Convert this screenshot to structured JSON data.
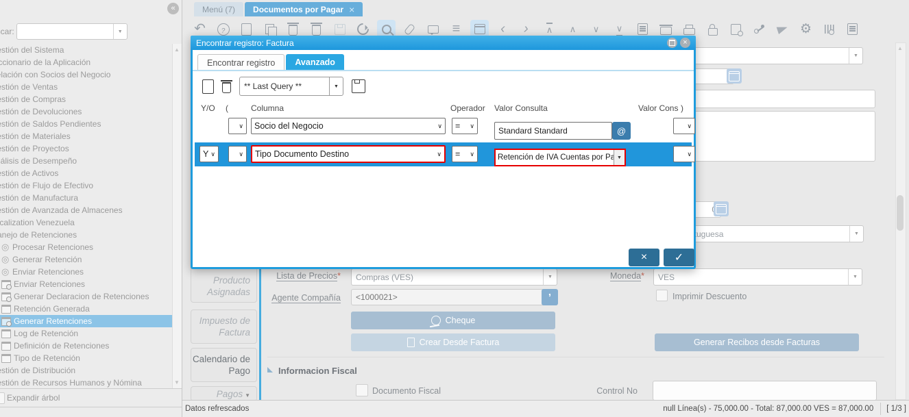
{
  "window": {
    "tabs": [
      {
        "label": "Menú (7)",
        "active": false
      },
      {
        "label": "Documentos por Pagar",
        "active": true,
        "close": "×"
      }
    ]
  },
  "sidebar": {
    "search_label": "Buscar:",
    "tree": [
      {
        "label": "Gestión del Sistema"
      },
      {
        "label": "Diccionario de la Aplicación"
      },
      {
        "label": "Relación con Socios del Negocio"
      },
      {
        "label": "Gestión de Ventas"
      },
      {
        "label": "Gestión de Compras"
      },
      {
        "label": "Gestión de Devoluciones"
      },
      {
        "label": "Gestión de Saldos Pendientes"
      },
      {
        "label": "Gestión de Materiales"
      },
      {
        "label": "Gestión de Proyectos"
      },
      {
        "label": "Análisis de Desempeño"
      },
      {
        "label": "Gestión de Activos"
      },
      {
        "label": "Gestión de Flujo de Efectivo"
      },
      {
        "label": "Gestión de Manufactura"
      },
      {
        "label": "Gestión de Avanzada de Almacenes"
      },
      {
        "label": "Localization Venezuela"
      },
      {
        "label": "Manejo de Retenciones"
      },
      {
        "label": "Procesar Retenciones",
        "icon": "process"
      },
      {
        "label": "Generar Retención",
        "icon": "process"
      },
      {
        "label": "Enviar Retenciones",
        "icon": "process"
      },
      {
        "label": "Enviar Retenciones",
        "icon": "window-process"
      },
      {
        "label": "Generar Declaracion de Retenciones",
        "icon": "window-process"
      },
      {
        "label": "Retención Generada",
        "icon": "window"
      },
      {
        "label": "Generar Retenciones",
        "icon": "window-process",
        "selected": true
      },
      {
        "label": "Log de Retención",
        "icon": "window"
      },
      {
        "label": "Definición de Retenciones",
        "icon": "window"
      },
      {
        "label": "Tipo de Retención",
        "icon": "window"
      },
      {
        "label": "Gestión de Distribución"
      },
      {
        "label": "Gestión de Recursos Humanos y Nómina"
      }
    ],
    "expand_label": "Expandir árbol"
  },
  "toolbar": {
    "icons": [
      "undo",
      "help",
      "new-record",
      "copy-record",
      "delete-record",
      "delete-selection",
      "save",
      "refresh",
      "find",
      "attachment",
      "chat",
      "grid-toggle",
      "calendar",
      "parent-record",
      "detail-record",
      "first-record",
      "previous-record",
      "next-record",
      "last-record",
      "report",
      "archive",
      "print",
      "lock",
      "zoom-across",
      "workflow",
      "send-mail",
      "preferences",
      "product-info",
      "report-layout"
    ],
    "active_icons": [
      "find",
      "calendar"
    ],
    "disabled_icons": [
      "save"
    ]
  },
  "dialog": {
    "title": "Encontrar registro: Factura",
    "tabs": [
      {
        "label": "Encontrar registro",
        "active": false
      },
      {
        "label": "Avanzado",
        "active": true
      }
    ],
    "saved_query": "** Last Query **",
    "headers": {
      "logic": "Y/O",
      "open": "(",
      "column": "Columna",
      "operator": "Operador",
      "value": "Valor Consulta",
      "value_to": "Valor Cons",
      "close": ")"
    },
    "rows": [
      {
        "logic": "",
        "paren": "",
        "column": "Socio del Negocio",
        "operator": "=",
        "value": "Standard Standard",
        "selected": false
      },
      {
        "logic": "Y",
        "paren": "",
        "column": "Tipo Documento Destino",
        "operator": "=",
        "value": "Retención de IVA Cuentas por Paga",
        "selected": true
      }
    ],
    "confirm": {
      "cancel": "×",
      "ok": "✓"
    }
  },
  "form": {
    "price_list": {
      "label": "Lista de Precios",
      "required": "*",
      "value": "Compras (VES)"
    },
    "currency": {
      "label": "Moneda",
      "required": "*",
      "value": "VES"
    },
    "company_agent": {
      "label": "Agente Compañía",
      "value": "<1000021>"
    },
    "print_discount_label": "Imprimir Descuento",
    "date_value": "0",
    "region_value": "Portuguesa",
    "buttons": {
      "cheque": "Cheque",
      "create_from_invoice": "Crear Desde Factura",
      "generate_receipts": "Generar Recibos desde Facturas"
    },
    "side_tabs": [
      {
        "label": "Producto Asignadas"
      },
      {
        "label": "Impuesto de Factura"
      },
      {
        "label": "Calendario de Pago"
      },
      {
        "label": "Pagos"
      }
    ],
    "fiscal": {
      "title": "Informacion Fiscal",
      "fiscal_document_label": "Documento Fiscal",
      "control_no_label": "Control No"
    }
  },
  "statusbar": {
    "message": "Datos refrescados",
    "totals": "null Línea(s) - 75,000.00 - Total: 87,000.00 VES = 87,000.00",
    "pager": "[ 1/3 ]"
  }
}
